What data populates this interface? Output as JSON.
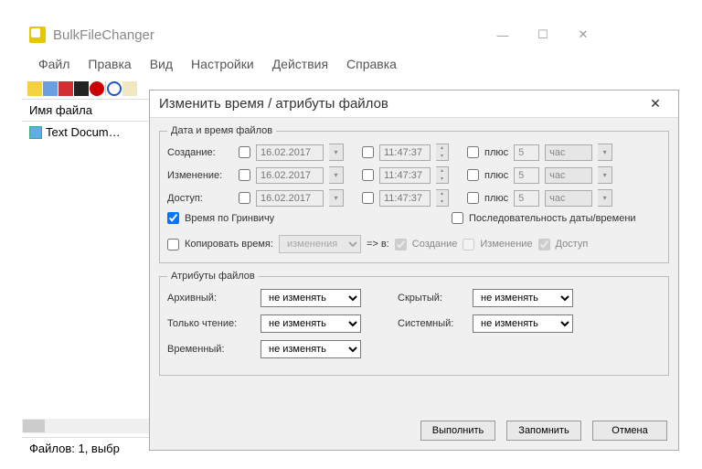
{
  "app": {
    "title": "BulkFileChanger",
    "menu": [
      "Файл",
      "Правка",
      "Вид",
      "Настройки",
      "Действия",
      "Справка"
    ],
    "list_header": "Имя файла",
    "file_row": "Text Docum…",
    "status": "Файлов: 1, выбр"
  },
  "dialog": {
    "title": "Изменить время / атрибуты файлов",
    "group_datetime": "Дата и время файлов",
    "group_attrs": "Атрибуты файлов",
    "lbl_created": "Создание:",
    "lbl_modified": "Изменение:",
    "lbl_accessed": "Доступ:",
    "date": "16.02.2017",
    "time": "11:47:37",
    "plus": "плюс",
    "plus_val": "5",
    "unit": "час",
    "greenwich": "Время по Гринвичу",
    "sequence": "Последовательность даты/времени",
    "copy_time": "Копировать время:",
    "copy_src": "изменения",
    "arrow_to": "=> в:",
    "copy_created": "Создание",
    "copy_modified": "Изменение",
    "copy_accessed": "Доступ",
    "attr_archive": "Архивный:",
    "attr_readonly": "Только чтение:",
    "attr_temp": "Временный:",
    "attr_hidden": "Скрытый:",
    "attr_system": "Системный:",
    "attr_nochange": "не изменять",
    "btn_execute": "Выполнить",
    "btn_remember": "Запомнить",
    "btn_cancel": "Отмена"
  }
}
